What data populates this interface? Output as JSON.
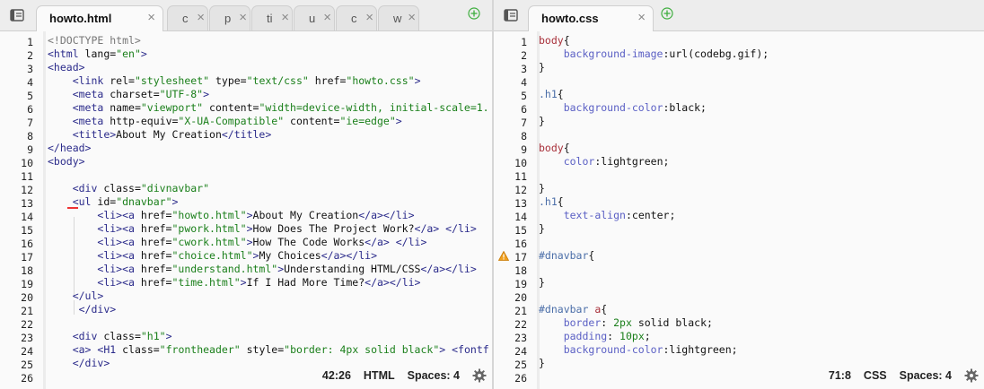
{
  "left_pane": {
    "tabs": [
      {
        "label": "howto.html",
        "active": true
      },
      {
        "label": "c"
      },
      {
        "label": "p"
      },
      {
        "label": "ti"
      },
      {
        "label": "u"
      },
      {
        "label": "c"
      },
      {
        "label": "w"
      }
    ],
    "close_glyph": "×",
    "line_numbers": [
      "1",
      "2",
      "3",
      "4",
      "5",
      "6",
      "7",
      "8",
      "9",
      "10",
      "11",
      "12",
      "13",
      "14",
      "15",
      "16",
      "17",
      "18",
      "19",
      "20",
      "21",
      "22",
      "23",
      "24",
      "25",
      "26"
    ],
    "status": {
      "cursor": "42:26",
      "mode": "HTML",
      "spaces": "Spaces: 4"
    }
  },
  "right_pane": {
    "tabs": [
      {
        "label": "howto.css",
        "active": true
      }
    ],
    "line_numbers": [
      "1",
      "2",
      "3",
      "4",
      "5",
      "6",
      "7",
      "8",
      "9",
      "10",
      "11",
      "12",
      "13",
      "14",
      "15",
      "16",
      "17",
      "18",
      "19",
      "20",
      "21",
      "22",
      "23",
      "24",
      "25",
      "26"
    ],
    "status": {
      "cursor": "71:8",
      "mode": "CSS",
      "spaces": "Spaces: 4"
    }
  },
  "html_code": [
    [
      [
        "doctype",
        "<!DOCTYPE html>"
      ]
    ],
    [
      [
        "tag",
        "<html"
      ],
      [
        "attr",
        " lang="
      ],
      [
        "str",
        "\"en\""
      ],
      [
        "tag",
        ">"
      ]
    ],
    [
      [
        "tag",
        "<head>"
      ]
    ],
    [
      [
        "pl",
        "    "
      ],
      [
        "tag",
        "<link"
      ],
      [
        "attr",
        " rel="
      ],
      [
        "str",
        "\"stylesheet\""
      ],
      [
        "attr",
        " type="
      ],
      [
        "str",
        "\"text/css\""
      ],
      [
        "attr",
        " href="
      ],
      [
        "str",
        "\"howto.css\""
      ],
      [
        "tag",
        ">"
      ]
    ],
    [
      [
        "pl",
        "    "
      ],
      [
        "tag",
        "<meta"
      ],
      [
        "attr",
        " charset="
      ],
      [
        "str",
        "\"UTF-8\""
      ],
      [
        "tag",
        ">"
      ]
    ],
    [
      [
        "pl",
        "    "
      ],
      [
        "tag",
        "<meta"
      ],
      [
        "attr",
        " name="
      ],
      [
        "str",
        "\"viewport\""
      ],
      [
        "attr",
        " content="
      ],
      [
        "str",
        "\"width=device-width, initial-scale=1."
      ]
    ],
    [
      [
        "pl",
        "    "
      ],
      [
        "tag",
        "<meta"
      ],
      [
        "attr",
        " http-equiv="
      ],
      [
        "str",
        "\"X-UA-Compatible\""
      ],
      [
        "attr",
        " content="
      ],
      [
        "str",
        "\"ie=edge\""
      ],
      [
        "tag",
        ">"
      ]
    ],
    [
      [
        "pl",
        "    "
      ],
      [
        "tag",
        "<title>"
      ],
      [
        "text",
        "About My Creation"
      ],
      [
        "tag",
        "</title>"
      ]
    ],
    [
      [
        "tag",
        "</head>"
      ]
    ],
    [
      [
        "tag",
        "<body>"
      ]
    ],
    [],
    [
      [
        "pl",
        "    "
      ],
      [
        "tag",
        "<div"
      ],
      [
        "attr",
        " class="
      ],
      [
        "str",
        "\"divnavbar\""
      ]
    ],
    [
      [
        "pl",
        "    "
      ],
      [
        "tag",
        "<ul"
      ],
      [
        "attr",
        " id="
      ],
      [
        "str",
        "\"dnavbar\""
      ],
      [
        "tag",
        ">"
      ]
    ],
    [
      [
        "pl",
        "        "
      ],
      [
        "tag",
        "<li><a"
      ],
      [
        "attr",
        " href="
      ],
      [
        "str",
        "\"howto.html\""
      ],
      [
        "tag",
        ">"
      ],
      [
        "text",
        "About My Creation"
      ],
      [
        "tag",
        "</a></li>"
      ]
    ],
    [
      [
        "pl",
        "        "
      ],
      [
        "tag",
        "<li><a"
      ],
      [
        "attr",
        " href="
      ],
      [
        "str",
        "\"pwork.html\""
      ],
      [
        "tag",
        ">"
      ],
      [
        "text",
        "How Does The Project Work?"
      ],
      [
        "tag",
        "</a> </li>"
      ]
    ],
    [
      [
        "pl",
        "        "
      ],
      [
        "tag",
        "<li><a"
      ],
      [
        "attr",
        " href="
      ],
      [
        "str",
        "\"cwork.html\""
      ],
      [
        "tag",
        ">"
      ],
      [
        "text",
        "How The Code Works"
      ],
      [
        "tag",
        "</a> </li>"
      ]
    ],
    [
      [
        "pl",
        "        "
      ],
      [
        "tag",
        "<li><a"
      ],
      [
        "attr",
        " href="
      ],
      [
        "str",
        "\"choice.html\""
      ],
      [
        "tag",
        ">"
      ],
      [
        "text",
        "My Choices"
      ],
      [
        "tag",
        "</a></li>"
      ]
    ],
    [
      [
        "pl",
        "        "
      ],
      [
        "tag",
        "<li><a"
      ],
      [
        "attr",
        " href="
      ],
      [
        "str",
        "\"understand.html\""
      ],
      [
        "tag",
        ">"
      ],
      [
        "text",
        "Understanding HTML/CSS"
      ],
      [
        "tag",
        "</a></li>"
      ]
    ],
    [
      [
        "pl",
        "        "
      ],
      [
        "tag",
        "<li><a"
      ],
      [
        "attr",
        " href="
      ],
      [
        "str",
        "\"time.html\""
      ],
      [
        "tag",
        ">"
      ],
      [
        "text",
        "If I Had More Time?"
      ],
      [
        "tag",
        "</a></li>"
      ]
    ],
    [
      [
        "pl",
        "    "
      ],
      [
        "tag",
        "</ul>"
      ]
    ],
    [
      [
        "pl",
        "     "
      ],
      [
        "tag",
        "</div>"
      ]
    ],
    [],
    [
      [
        "pl",
        "    "
      ],
      [
        "tag",
        "<div"
      ],
      [
        "attr",
        " class="
      ],
      [
        "str",
        "\"h1\""
      ],
      [
        "tag",
        ">"
      ]
    ],
    [
      [
        "pl",
        "    "
      ],
      [
        "tag",
        "<a>"
      ],
      [
        "pl",
        " "
      ],
      [
        "tag",
        "<H1"
      ],
      [
        "attr",
        " class="
      ],
      [
        "str",
        "\"frontheader\""
      ],
      [
        "attr",
        " style="
      ],
      [
        "str",
        "\"border: 4px solid black\""
      ],
      [
        "tag",
        ">"
      ],
      [
        "pl",
        " "
      ],
      [
        "tag",
        "<fontf"
      ]
    ],
    [
      [
        "pl",
        "    "
      ],
      [
        "tag",
        "</div>"
      ]
    ],
    []
  ],
  "css_code": [
    [
      [
        "sel",
        "body"
      ],
      [
        "punc",
        "{"
      ]
    ],
    [
      [
        "pl",
        "    "
      ],
      [
        "prop",
        "background-image"
      ],
      [
        "punc",
        ":"
      ],
      [
        "val",
        "url(codebg.gif)"
      ],
      [
        "punc",
        ";"
      ]
    ],
    [
      [
        "punc",
        "}"
      ]
    ],
    [],
    [
      [
        "class",
        ".h1"
      ],
      [
        "punc",
        "{"
      ]
    ],
    [
      [
        "pl",
        "    "
      ],
      [
        "prop",
        "background-color"
      ],
      [
        "punc",
        ":"
      ],
      [
        "val",
        "black"
      ],
      [
        "punc",
        ";"
      ]
    ],
    [
      [
        "punc",
        "}"
      ]
    ],
    [],
    [
      [
        "sel",
        "body"
      ],
      [
        "punc",
        "{"
      ]
    ],
    [
      [
        "pl",
        "    "
      ],
      [
        "prop",
        "color"
      ],
      [
        "punc",
        ":"
      ],
      [
        "val",
        "lightgreen"
      ],
      [
        "punc",
        ";"
      ]
    ],
    [],
    [
      [
        "punc",
        "}"
      ]
    ],
    [
      [
        "class",
        ".h1"
      ],
      [
        "punc",
        "{"
      ]
    ],
    [
      [
        "pl",
        "    "
      ],
      [
        "prop",
        "text-align"
      ],
      [
        "punc",
        ":"
      ],
      [
        "val",
        "center"
      ],
      [
        "punc",
        ";"
      ]
    ],
    [
      [
        "punc",
        "}"
      ]
    ],
    [],
    [
      [
        "id",
        "#dnavbar"
      ],
      [
        "punc",
        "{"
      ]
    ],
    [],
    [
      [
        "punc",
        "}"
      ]
    ],
    [],
    [
      [
        "id",
        "#dnavbar"
      ],
      [
        "sel",
        " a"
      ],
      [
        "punc",
        "{"
      ]
    ],
    [
      [
        "pl",
        "    "
      ],
      [
        "prop",
        "border"
      ],
      [
        "punc",
        ": "
      ],
      [
        "num",
        "2"
      ],
      [
        "num",
        "px"
      ],
      [
        "val",
        " solid black"
      ],
      [
        "punc",
        ";"
      ]
    ],
    [
      [
        "pl",
        "    "
      ],
      [
        "prop",
        "padding"
      ],
      [
        "punc",
        ": "
      ],
      [
        "num",
        "10"
      ],
      [
        "num",
        "px"
      ],
      [
        "punc",
        ";"
      ]
    ],
    [
      [
        "pl",
        "    "
      ],
      [
        "prop",
        "background-color"
      ],
      [
        "punc",
        ":"
      ],
      [
        "val",
        "lightgreen"
      ],
      [
        "punc",
        ";"
      ]
    ],
    [
      [
        "punc",
        "}"
      ]
    ],
    []
  ],
  "colors": {
    "tag": "#2a2a8a",
    "string": "#1a7f1a",
    "selector": "#a8303a",
    "property": "#5a5fc4"
  },
  "icons": [
    "sidebar-toggle-icon",
    "close-icon",
    "add-tab-icon",
    "warning-icon",
    "gear-icon"
  ]
}
